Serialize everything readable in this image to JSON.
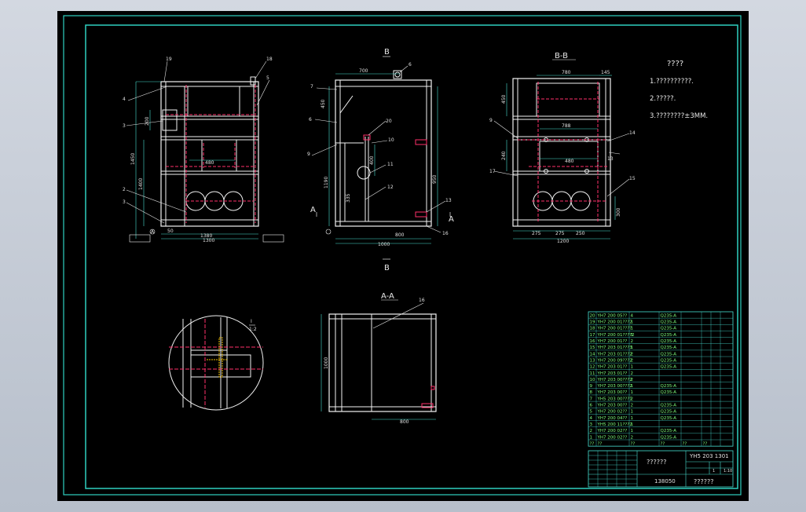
{
  "colors": {
    "background": "#000000",
    "frame": "#2fd0c0",
    "geometry": "#f2f2f2",
    "dimension": "#48e0d2",
    "hidden": "#ff2f6a",
    "leader": "#e8e8e8",
    "table_text": "#7fff7f"
  },
  "views": {
    "front_leaders": [
      "19",
      "18",
      "4",
      "5",
      "3",
      "2",
      "3"
    ],
    "front_dims": [
      "1380",
      "1300",
      "1400",
      "1450",
      "480",
      "200",
      "50"
    ],
    "front_section_mark": "A",
    "side_leaders": [
      "7",
      "6",
      "20",
      "10",
      "9",
      "11",
      "12",
      "13",
      "16",
      "6"
    ],
    "side_dims": [
      "700",
      "1000",
      "800",
      "600",
      "1190",
      "335",
      "950",
      "400",
      "450"
    ],
    "side_cut_labels": [
      "B",
      "B",
      "A",
      "A"
    ],
    "section_bb_title": "B-B",
    "section_bb_leaders": [
      "9",
      "14",
      "17",
      "15",
      "13"
    ],
    "section_bb_dims": [
      "780",
      "145",
      "450",
      "480",
      "240",
      "275",
      "275",
      "250",
      "1200",
      "300",
      "788"
    ],
    "section_aa_title": "A-A",
    "section_aa_leader": "16",
    "section_aa_dims": [
      "1000",
      "800"
    ],
    "detail_label_num": "I",
    "detail_label_scale": "1:2"
  },
  "notes": {
    "heading": "????",
    "items": [
      "1.??????????.",
      "2.?????.",
      "3.????????±3MM."
    ]
  },
  "bom": {
    "rows": [
      [
        "20",
        "YH7 200 05??",
        "4",
        "Q235-A",
        ""
      ],
      [
        "19",
        "YH7 200 01???2",
        "1",
        "Q235-A",
        ""
      ],
      [
        "18",
        "YH7 200 01????",
        "1",
        "Q235-A",
        ""
      ],
      [
        "17",
        "YH7 200 01????2",
        "1",
        "Q235-A",
        ""
      ],
      [
        "16",
        "YH7 200 01??",
        "2",
        "Q235-A",
        ""
      ],
      [
        "15",
        "YH7 203 01???3",
        "1",
        "Q235-A",
        ""
      ],
      [
        "14",
        "YH7 203 01???2",
        "2",
        "Q235-A",
        ""
      ],
      [
        "13",
        "YH7 200 09???2",
        "2",
        "Q235-A",
        ""
      ],
      [
        "12",
        "YH7 203 01??",
        "1",
        "Q235-A",
        ""
      ],
      [
        "11",
        "YH7 203 01??",
        "2",
        "",
        ""
      ],
      [
        "10",
        "YH7 203 00???2",
        "2",
        "",
        ""
      ],
      [
        "9",
        "YH7 203 00???2",
        "1",
        "Q235-A",
        ""
      ],
      [
        "8",
        "YH7 203 00??",
        "1",
        "Q235-A",
        ""
      ],
      [
        "7",
        "YH5 203 00???1",
        "2",
        "",
        ""
      ],
      [
        "6",
        "YH7 203 00??",
        "2",
        "Q235-A",
        ""
      ],
      [
        "5",
        "YH7 200 02??",
        "1",
        "Q235-A",
        ""
      ],
      [
        "4",
        "YH7 200 04??",
        "1",
        "Q235-A",
        ""
      ],
      [
        "3",
        "YH5 200 11???2",
        "1",
        "",
        ""
      ],
      [
        "2",
        "YH7 200 02??",
        "1",
        "Q235-A",
        ""
      ],
      [
        "1",
        "YH7 200 02??",
        "2",
        "Q235-A",
        ""
      ]
    ],
    "header": [
      "??",
      "??",
      "??",
      "??",
      "??",
      "??"
    ]
  },
  "title_block": {
    "name": "??????",
    "drawing_no": "YH5 203 1301",
    "scale": "1:10",
    "sheet_no": "1",
    "company": "??????",
    "material_code": "138050"
  }
}
